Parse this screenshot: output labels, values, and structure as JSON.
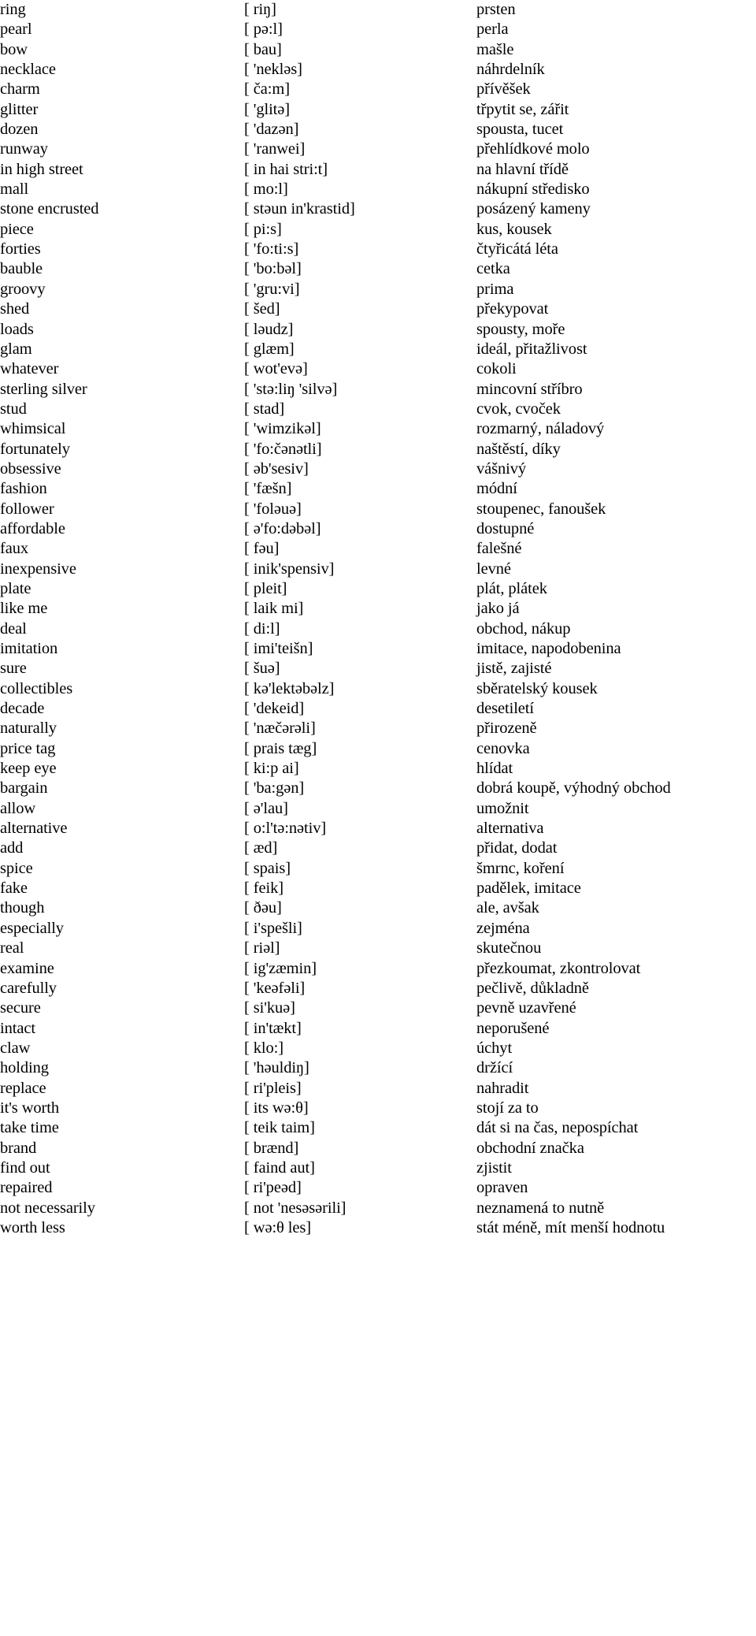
{
  "document": {
    "type": "vocabulary-list",
    "language_pair": "English - Czech",
    "columns": [
      "term",
      "pronunciation",
      "translation"
    ],
    "text_color": "#000000",
    "background_color": "#ffffff"
  },
  "rows": [
    {
      "term": "ring",
      "pron": "[ riŋ]",
      "trans": "prsten"
    },
    {
      "term": "pearl",
      "pron": "[ pə:l]",
      "trans": "perla"
    },
    {
      "term": "bow",
      "pron": "[ bau]",
      "trans": "mašle"
    },
    {
      "term": "necklace",
      "pron": "[ 'nekləs]",
      "trans": "náhrdelník"
    },
    {
      "term": "charm",
      "pron": "[ ča:m]",
      "trans": "přívěšek"
    },
    {
      "term": "glitter",
      "pron": "[ 'glitə]",
      "trans": "třpytit se, zářit"
    },
    {
      "term": "dozen",
      "pron": "[ 'dazən]",
      "trans": "spousta, tucet"
    },
    {
      "term": "runway",
      "pron": "[ 'ranwei]",
      "trans": "přehlídkové molo"
    },
    {
      "term": "in high street",
      "pron": "[ in hai stri:t]",
      "trans": "na hlavní třídě"
    },
    {
      "term": "mall",
      "pron": "[ mo:l]",
      "trans": "nákupní středisko"
    },
    {
      "term": "stone encrusted",
      "pron": "[ stəun in'krastid]",
      "trans": "posázený kameny"
    },
    {
      "term": "piece",
      "pron": "[ pi:s]",
      "trans": "kus, kousek"
    },
    {
      "term": "forties",
      "pron": "[ 'fo:ti:s]",
      "trans": "čtyřicátá léta"
    },
    {
      "term": "bauble",
      "pron": "[ 'bo:bəl]",
      "trans": "cetka"
    },
    {
      "term": "groovy",
      "pron": "[ 'gru:vi]",
      "trans": "prima"
    },
    {
      "term": "shed",
      "pron": "[ šed]",
      "trans": "překypovat"
    },
    {
      "term": "loads",
      "pron": "[ ləudz]",
      "trans": "spousty, moře"
    },
    {
      "term": "glam",
      "pron": "[ glæm]",
      "trans": "ideál, přitažlivost"
    },
    {
      "term": "whatever",
      "pron": "[ wot'evə]",
      "trans": "cokoli"
    },
    {
      "term": "sterling silver",
      "pron": "[ 'stə:liŋ 'silvə]",
      "trans": "mincovní stříbro"
    },
    {
      "term": "stud",
      "pron": "[ stad]",
      "trans": "cvok, cvoček"
    },
    {
      "term": "whimsical",
      "pron": "[ 'wimzikəl]",
      "trans": "rozmarný, náladový"
    },
    {
      "term": "fortunately",
      "pron": "[ 'fo:čənətli]",
      "trans": "naštěstí, díky"
    },
    {
      "term": "obsessive",
      "pron": "[ əb'sesiv]",
      "trans": "vášnivý"
    },
    {
      "term": "fashion",
      "pron": "[ 'fæšn]",
      "trans": "módní"
    },
    {
      "term": "follower",
      "pron": "[ 'foləuə]",
      "trans": "stoupenec, fanoušek"
    },
    {
      "term": "affordable",
      "pron": "[ ə'fo:dəbəl]",
      "trans": "dostupné"
    },
    {
      "term": "faux",
      "pron": "[ fəu]",
      "trans": "falešné"
    },
    {
      "term": "inexpensive",
      "pron": "[ inik'spensiv]",
      "trans": "levné"
    },
    {
      "term": "plate",
      "pron": "[ pleit]",
      "trans": "plát, plátek"
    },
    {
      "term": "like me",
      "pron": "[ laik mi]",
      "trans": "jako já"
    },
    {
      "term": "deal",
      "pron": "[ di:l]",
      "trans": "obchod, nákup"
    },
    {
      "term": "imitation",
      "pron": "[ imi'teišn]",
      "trans": "imitace, napodobenina"
    },
    {
      "term": "sure",
      "pron": "[ šuə]",
      "trans": "jistě, zajisté"
    },
    {
      "term": "collectibles",
      "pron": "[ kə'lektəbəlz]",
      "trans": "sběratelský kousek"
    },
    {
      "term": "decade",
      "pron": "[ 'dekeid]",
      "trans": "desetiletí"
    },
    {
      "term": "naturally",
      "pron": "[ 'næčərəli]",
      "trans": "přirozeně"
    },
    {
      "term": "price tag",
      "pron": "[ prais tæg]",
      "trans": "cenovka"
    },
    {
      "term": "keep eye",
      "pron": "[ ki:p ai]",
      "trans": "hlídat"
    },
    {
      "term": "bargain",
      "pron": "[ 'ba:gən]",
      "trans": "dobrá koupě, výhodný obchod"
    },
    {
      "term": "allow",
      "pron": "[ ə'lau]",
      "trans": "umožnit"
    },
    {
      "term": "alternative",
      "pron": "[ o:l'tə:nətiv]",
      "trans": "alternativa"
    },
    {
      "term": "add",
      "pron": "[ æd]",
      "trans": "přidat, dodat"
    },
    {
      "term": "spice",
      "pron": "[ spais]",
      "trans": "šmrnc, koření"
    },
    {
      "term": "fake",
      "pron": "[ feik]",
      "trans": "padělek, imitace"
    },
    {
      "term": "though",
      "pron": "[ ðəu]",
      "trans": "ale, avšak"
    },
    {
      "term": "especially",
      "pron": "[ i'spešli]",
      "trans": "zejména"
    },
    {
      "term": "real",
      "pron": "[ riəl]",
      "trans": "skutečnou"
    },
    {
      "term": "examine",
      "pron": "[ ig'zæmin]",
      "trans": "přezkoumat, zkontrolovat"
    },
    {
      "term": "carefully",
      "pron": "[ 'keəfəli]",
      "trans": "pečlivě, důkladně"
    },
    {
      "term": "secure",
      "pron": "[ si'kuə]",
      "trans": "pevně uzavřené"
    },
    {
      "term": "intact",
      "pron": "[ in'tækt]",
      "trans": "neporušené"
    },
    {
      "term": "claw",
      "pron": "[ klo:]",
      "trans": "úchyt"
    },
    {
      "term": "holding",
      "pron": "[ 'həuldiŋ]",
      "trans": "držící"
    },
    {
      "term": "replace",
      "pron": "[ ri'pleis]",
      "trans": "nahradit"
    },
    {
      "term": "it's worth",
      "pron": "[ its wə:θ]",
      "trans": "stojí za to"
    },
    {
      "term": "take time",
      "pron": "[ teik taim]",
      "trans": "dát si na čas, nepospíchat"
    },
    {
      "term": "brand",
      "pron": "[ brænd]",
      "trans": "obchodní značka"
    },
    {
      "term": "find out",
      "pron": "[ faind aut]",
      "trans": "zjistit"
    },
    {
      "term": "repaired",
      "pron": "[ ri'peəd]",
      "trans": "opraven"
    },
    {
      "term": "not necessarily",
      "pron": "[ not 'nesəsərili]",
      "trans": "neznamená to nutně"
    },
    {
      "term": "worth less",
      "pron": "[ wə:θ les]",
      "trans": "stát méně, mít menší hodnotu"
    }
  ]
}
